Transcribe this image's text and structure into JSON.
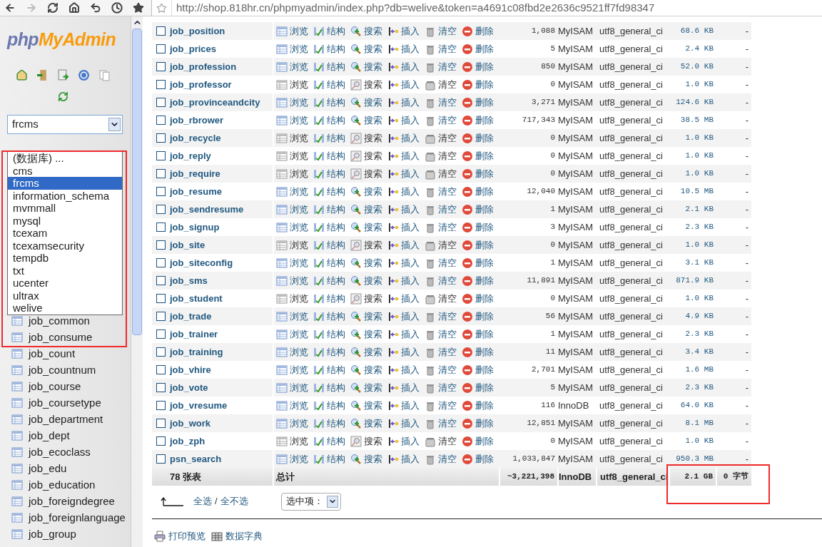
{
  "browser": {
    "url": "http://shop.818hr.cn/phpmyadmin/index.php?db=welive&token=a4691c08fbd2e2636c9521ff7fd98347"
  },
  "sidebar": {
    "logo": {
      "part_1": "php",
      "part_2": "MyAdmin"
    },
    "database_select": {
      "value": "frcms"
    },
    "dropdown_options": [
      {
        "label": "(数据库) ...",
        "selected": false
      },
      {
        "label": "cms",
        "selected": false
      },
      {
        "label": "frcms",
        "selected": true
      },
      {
        "label": "information_schema",
        "selected": false
      },
      {
        "label": "mvmmall",
        "selected": false
      },
      {
        "label": "mysql",
        "selected": false
      },
      {
        "label": "tcexam",
        "selected": false
      },
      {
        "label": "tcexamsecurity",
        "selected": false
      },
      {
        "label": "tempdb",
        "selected": false
      },
      {
        "label": "txt",
        "selected": false
      },
      {
        "label": "ucenter",
        "selected": false
      },
      {
        "label": "ultrax",
        "selected": false
      },
      {
        "label": "welive",
        "selected": false
      }
    ],
    "tables": [
      "job_common",
      "job_consume",
      "job_count",
      "job_countnum",
      "job_course",
      "job_coursetype",
      "job_department",
      "job_dept",
      "job_ecoclass",
      "job_edu",
      "job_education",
      "job_foreigndegree",
      "job_foreignlanguage",
      "job_group"
    ]
  },
  "table": {
    "rows": [
      {
        "checked": false,
        "name": "job_position",
        "empty": false,
        "actions": [
          "浏览",
          "结构",
          "搜索",
          "插入",
          "清空",
          "删除"
        ],
        "records": "1,088",
        "engine": "MyISAM",
        "collation": "utf8_general_ci",
        "size": "68.6 KB",
        "overhead": "-"
      },
      {
        "checked": false,
        "name": "job_prices",
        "empty": false,
        "actions": [
          "浏览",
          "结构",
          "搜索",
          "插入",
          "清空",
          "删除"
        ],
        "records": "5",
        "engine": "MyISAM",
        "collation": "utf8_general_ci",
        "size": "2.4 KB",
        "overhead": "-"
      },
      {
        "checked": false,
        "name": "job_profession",
        "empty": false,
        "actions": [
          "浏览",
          "结构",
          "搜索",
          "插入",
          "清空",
          "删除"
        ],
        "records": "850",
        "engine": "MyISAM",
        "collation": "utf8_general_ci",
        "size": "52.0 KB",
        "overhead": "-"
      },
      {
        "checked": false,
        "name": "job_professor",
        "empty": true,
        "actions": [
          "浏览",
          "结构",
          "搜索",
          "插入",
          "清空",
          "删除"
        ],
        "records": "0",
        "engine": "MyISAM",
        "collation": "utf8_general_ci",
        "size": "1.0 KB",
        "overhead": "-"
      },
      {
        "checked": false,
        "name": "job_provinceandcity",
        "empty": false,
        "actions": [
          "浏览",
          "结构",
          "搜索",
          "插入",
          "清空",
          "删除"
        ],
        "records": "3,271",
        "engine": "MyISAM",
        "collation": "utf8_general_ci",
        "size": "124.6 KB",
        "overhead": "-"
      },
      {
        "checked": false,
        "name": "job_rbrower",
        "empty": false,
        "actions": [
          "浏览",
          "结构",
          "搜索",
          "插入",
          "清空",
          "删除"
        ],
        "records": "717,343",
        "engine": "MyISAM",
        "collation": "utf8_general_ci",
        "size": "38.5 MB",
        "overhead": "-"
      },
      {
        "checked": false,
        "name": "job_recycle",
        "empty": true,
        "actions": [
          "浏览",
          "结构",
          "搜索",
          "插入",
          "清空",
          "删除"
        ],
        "records": "0",
        "engine": "MyISAM",
        "collation": "utf8_general_ci",
        "size": "1.0 KB",
        "overhead": "-"
      },
      {
        "checked": false,
        "name": "job_reply",
        "empty": true,
        "actions": [
          "浏览",
          "结构",
          "搜索",
          "插入",
          "清空",
          "删除"
        ],
        "records": "0",
        "engine": "MyISAM",
        "collation": "utf8_general_ci",
        "size": "1.0 KB",
        "overhead": "-"
      },
      {
        "checked": false,
        "name": "job_require",
        "empty": true,
        "actions": [
          "浏览",
          "结构",
          "搜索",
          "插入",
          "清空",
          "删除"
        ],
        "records": "0",
        "engine": "MyISAM",
        "collation": "utf8_general_ci",
        "size": "1.0 KB",
        "overhead": "-"
      },
      {
        "checked": false,
        "name": "job_resume",
        "empty": false,
        "actions": [
          "浏览",
          "结构",
          "搜索",
          "插入",
          "清空",
          "删除"
        ],
        "records": "12,040",
        "engine": "MyISAM",
        "collation": "utf8_general_ci",
        "size": "10.5 MB",
        "overhead": "-"
      },
      {
        "checked": false,
        "name": "job_sendresume",
        "empty": false,
        "actions": [
          "浏览",
          "结构",
          "搜索",
          "插入",
          "清空",
          "删除"
        ],
        "records": "1",
        "engine": "MyISAM",
        "collation": "utf8_general_ci",
        "size": "2.1 KB",
        "overhead": "-"
      },
      {
        "checked": false,
        "name": "job_signup",
        "empty": false,
        "actions": [
          "浏览",
          "结构",
          "搜索",
          "插入",
          "清空",
          "删除"
        ],
        "records": "3",
        "engine": "MyISAM",
        "collation": "utf8_general_ci",
        "size": "2.3 KB",
        "overhead": "-"
      },
      {
        "checked": false,
        "name": "job_site",
        "empty": true,
        "actions": [
          "浏览",
          "结构",
          "搜索",
          "插入",
          "清空",
          "删除"
        ],
        "records": "0",
        "engine": "MyISAM",
        "collation": "utf8_general_ci",
        "size": "1.0 KB",
        "overhead": "-"
      },
      {
        "checked": false,
        "name": "job_siteconfig",
        "empty": false,
        "actions": [
          "浏览",
          "结构",
          "搜索",
          "插入",
          "清空",
          "删除"
        ],
        "records": "1",
        "engine": "MyISAM",
        "collation": "utf8_general_ci",
        "size": "3.1 KB",
        "overhead": "-"
      },
      {
        "checked": false,
        "name": "job_sms",
        "empty": false,
        "actions": [
          "浏览",
          "结构",
          "搜索",
          "插入",
          "清空",
          "删除"
        ],
        "records": "11,891",
        "engine": "MyISAM",
        "collation": "utf8_general_ci",
        "size": "871.9 KB",
        "overhead": "-"
      },
      {
        "checked": false,
        "name": "job_student",
        "empty": true,
        "actions": [
          "浏览",
          "结构",
          "搜索",
          "插入",
          "清空",
          "删除"
        ],
        "records": "0",
        "engine": "MyISAM",
        "collation": "utf8_general_ci",
        "size": "1.0 KB",
        "overhead": "-"
      },
      {
        "checked": false,
        "name": "job_trade",
        "empty": false,
        "actions": [
          "浏览",
          "结构",
          "搜索",
          "插入",
          "清空",
          "删除"
        ],
        "records": "56",
        "engine": "MyISAM",
        "collation": "utf8_general_ci",
        "size": "4.9 KB",
        "overhead": "-"
      },
      {
        "checked": false,
        "name": "job_trainer",
        "empty": false,
        "actions": [
          "浏览",
          "结构",
          "搜索",
          "插入",
          "清空",
          "删除"
        ],
        "records": "1",
        "engine": "MyISAM",
        "collation": "utf8_general_ci",
        "size": "2.3 KB",
        "overhead": "-"
      },
      {
        "checked": false,
        "name": "job_training",
        "empty": false,
        "actions": [
          "浏览",
          "结构",
          "搜索",
          "插入",
          "清空",
          "删除"
        ],
        "records": "11",
        "engine": "MyISAM",
        "collation": "utf8_general_ci",
        "size": "3.4 KB",
        "overhead": "-"
      },
      {
        "checked": false,
        "name": "job_vhire",
        "empty": false,
        "actions": [
          "浏览",
          "结构",
          "搜索",
          "插入",
          "清空",
          "删除"
        ],
        "records": "2,701",
        "engine": "MyISAM",
        "collation": "utf8_general_ci",
        "size": "1.6 MB",
        "overhead": "-"
      },
      {
        "checked": false,
        "name": "job_vote",
        "empty": false,
        "actions": [
          "浏览",
          "结构",
          "搜索",
          "插入",
          "清空",
          "删除"
        ],
        "records": "5",
        "engine": "MyISAM",
        "collation": "utf8_general_ci",
        "size": "2.3 KB",
        "overhead": "-"
      },
      {
        "checked": false,
        "name": "job_vresume",
        "empty": false,
        "actions": [
          "浏览",
          "结构",
          "搜索",
          "插入",
          "清空",
          "删除"
        ],
        "records": "116",
        "engine": "InnoDB",
        "collation": "utf8_general_ci",
        "size": "64.0 KB",
        "overhead": "-"
      },
      {
        "checked": false,
        "name": "job_work",
        "empty": false,
        "actions": [
          "浏览",
          "结构",
          "搜索",
          "插入",
          "清空",
          "删除"
        ],
        "records": "12,851",
        "engine": "MyISAM",
        "collation": "utf8_general_ci",
        "size": "8.1 MB",
        "overhead": "-"
      },
      {
        "checked": false,
        "name": "job_zph",
        "empty": true,
        "actions": [
          "浏览",
          "结构",
          "搜索",
          "插入",
          "清空",
          "删除"
        ],
        "records": "0",
        "engine": "MyISAM",
        "collation": "utf8_general_ci",
        "size": "1.0 KB",
        "overhead": "-"
      },
      {
        "checked": false,
        "name": "psn_search",
        "empty": false,
        "actions": [
          "浏览",
          "结构",
          "搜索",
          "插入",
          "清空",
          "删除"
        ],
        "records": "1,033,847",
        "engine": "MyISAM",
        "collation": "utf8_general_ci",
        "size": "950.3 MB",
        "overhead": "-"
      }
    ],
    "footer": {
      "count": "78 张表",
      "label": "总计",
      "records": "~3,221,398",
      "engine": "InnoDB",
      "collation": "utf8_general_ci",
      "size": "2.1 GB",
      "overhead": "0 字节"
    }
  },
  "bulk": {
    "select_all": "全选",
    "separator": "/",
    "deselect_all": "全不选",
    "with_selected": "选中项："
  },
  "links": [
    "打印预览",
    "数据字典"
  ]
}
